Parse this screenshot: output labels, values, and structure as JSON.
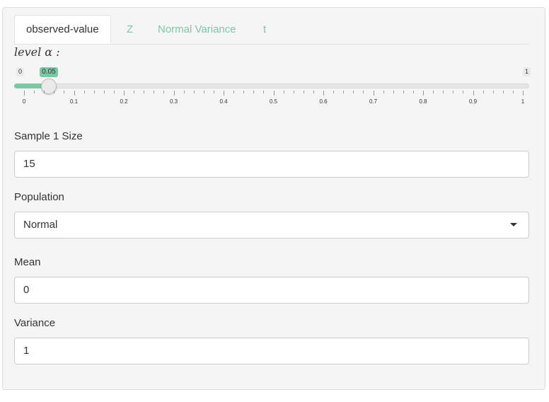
{
  "tabs": [
    "observed-value",
    "Z",
    "Normal Variance",
    "t"
  ],
  "slider": {
    "label": "level α :",
    "min_label": "0",
    "max_label": "1",
    "value": 0.05,
    "value_label": "0.05",
    "tick_labels": [
      "0",
      "0.1",
      "0.2",
      "0.3",
      "0.4",
      "0.5",
      "0.6",
      "0.7",
      "0.8",
      "0.9",
      "1"
    ]
  },
  "sample_size": {
    "label": "Sample 1 Size",
    "value": "15"
  },
  "population": {
    "label": "Population",
    "selected": "Normal"
  },
  "mean": {
    "label": "Mean",
    "value": "0"
  },
  "variance": {
    "label": "Variance",
    "value": "1"
  },
  "colors": {
    "accent": "#7cc8a5"
  }
}
